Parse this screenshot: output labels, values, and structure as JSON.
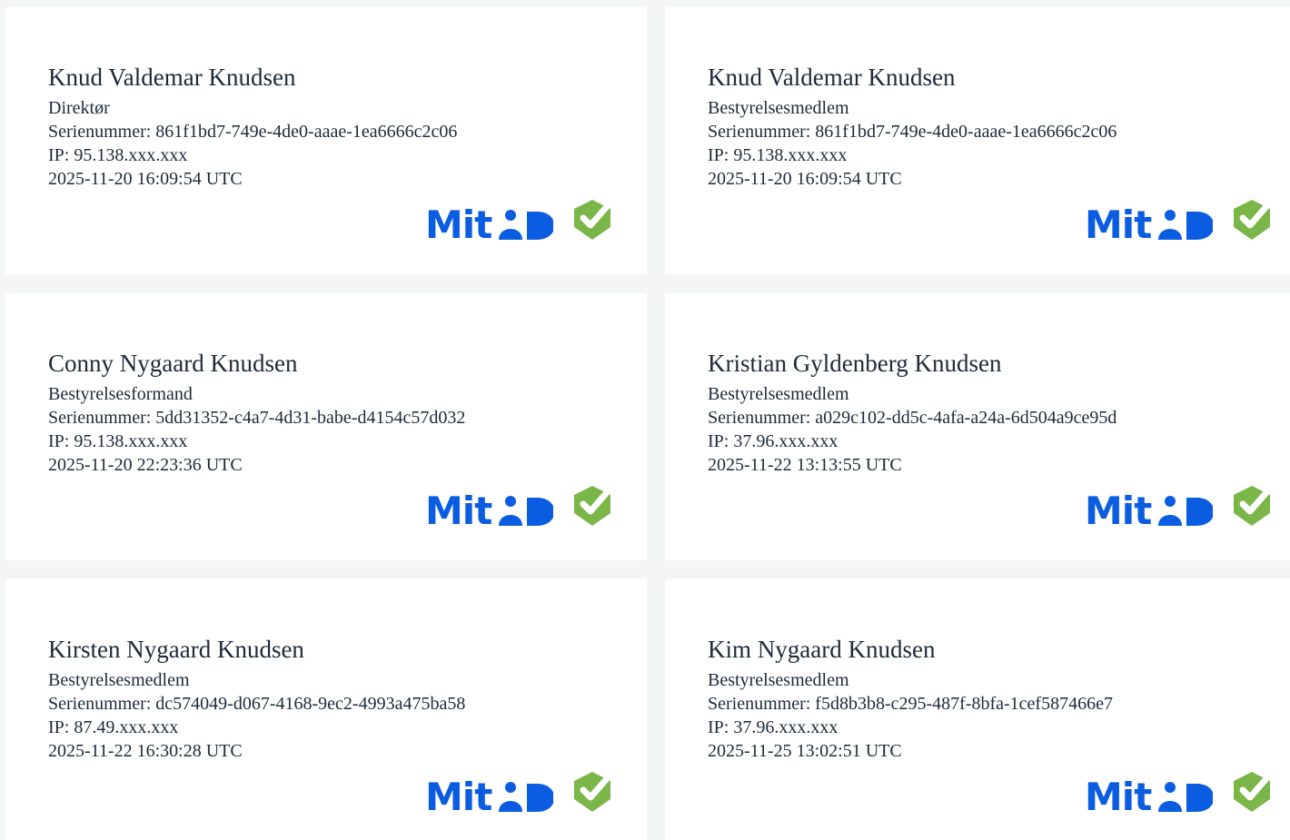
{
  "brand": {
    "mit": "Mit",
    "primary_color": "#0a5ce0",
    "check_color": "#7ab648"
  },
  "signatures": [
    {
      "name": "Knud Valdemar Knudsen",
      "role": "Direktør",
      "serial": "Serienummer: 861f1bd7-749e-4de0-aaae-1ea6666c2c06",
      "ip": "IP: 95.138.xxx.xxx",
      "timestamp": "2025-11-20 16:09:54 UTC"
    },
    {
      "name": "Knud Valdemar Knudsen",
      "role": "Bestyrelsesmedlem",
      "serial": "Serienummer: 861f1bd7-749e-4de0-aaae-1ea6666c2c06",
      "ip": "IP: 95.138.xxx.xxx",
      "timestamp": "2025-11-20 16:09:54 UTC"
    },
    {
      "name": "Conny Nygaard Knudsen",
      "role": "Bestyrelsesformand",
      "serial": "Serienummer: 5dd31352-c4a7-4d31-babe-d4154c57d032",
      "ip": "IP: 95.138.xxx.xxx",
      "timestamp": "2025-11-20 22:23:36 UTC"
    },
    {
      "name": "Kristian Gyldenberg Knudsen",
      "role": "Bestyrelsesmedlem",
      "serial": "Serienummer: a029c102-dd5c-4afa-a24a-6d504a9ce95d",
      "ip": "IP: 37.96.xxx.xxx",
      "timestamp": "2025-11-22 13:13:55 UTC"
    },
    {
      "name": "Kirsten Nygaard Knudsen",
      "role": "Bestyrelsesmedlem",
      "serial": "Serienummer: dc574049-d067-4168-9ec2-4993a475ba58",
      "ip": "IP: 87.49.xxx.xxx",
      "timestamp": "2025-11-22 16:30:28 UTC"
    },
    {
      "name": "Kim Nygaard Knudsen",
      "role": "Bestyrelsesmedlem",
      "serial": "Serienummer: f5d8b3b8-c295-487f-8bfa-1cef587466e7",
      "ip": "IP: 37.96.xxx.xxx",
      "timestamp": "2025-11-25 13:02:51 UTC"
    }
  ]
}
